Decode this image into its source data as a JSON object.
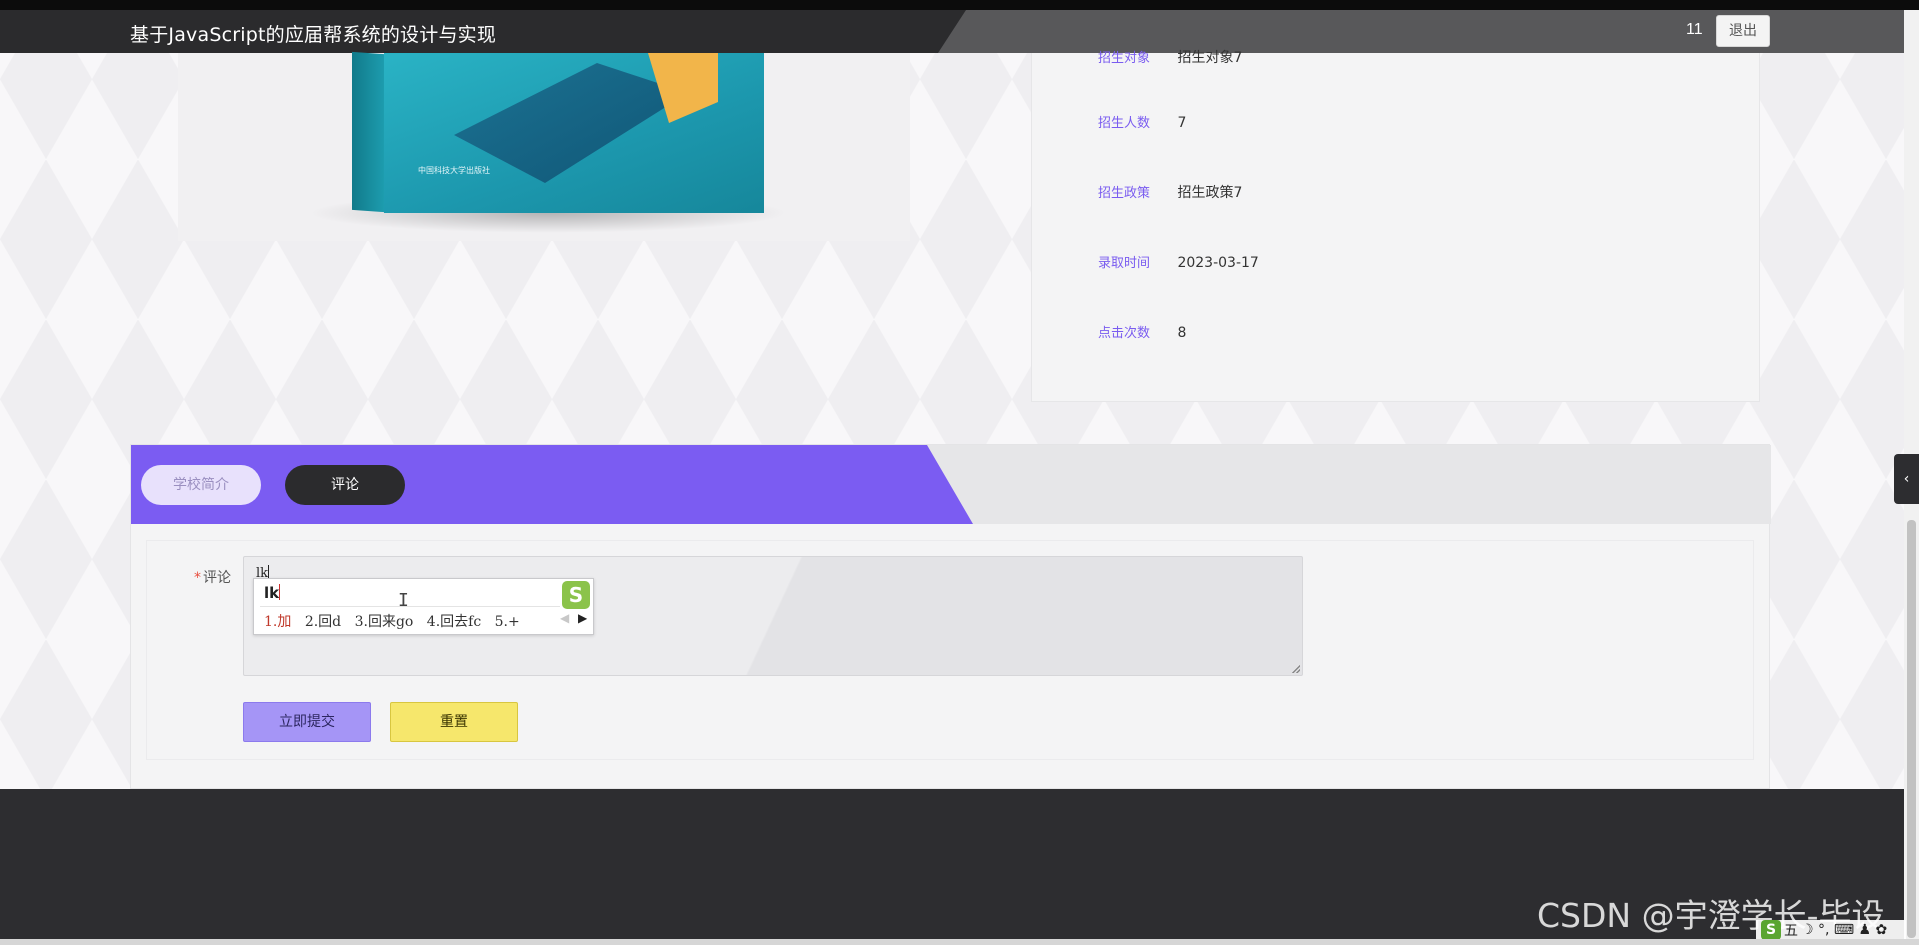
{
  "header": {
    "site_title": "基于JavaScript的应届帮系统的设计与实现",
    "user_name": "11",
    "logout_label": "退出"
  },
  "product_image": {
    "publisher_text": "中国科技大学出版社"
  },
  "details": [
    {
      "label": "招生对象",
      "value": "招生对象7"
    },
    {
      "label": "招生人数",
      "value": "7"
    },
    {
      "label": "招生政策",
      "value": "招生政策7"
    },
    {
      "label": "录取时间",
      "value": "2023-03-17"
    },
    {
      "label": "点击次数",
      "value": "8"
    }
  ],
  "tabs": [
    {
      "label": "学校简介",
      "active": false
    },
    {
      "label": "评论",
      "active": true
    }
  ],
  "form": {
    "required_mark": "*",
    "comment_label": "评论",
    "comment_value": "lk",
    "submit_label": "立即提交",
    "reset_label": "重置"
  },
  "ime": {
    "composition": "lk",
    "candidates": [
      "1.加",
      "2.回d",
      "3.回来go",
      "4.回去fc",
      "5.+"
    ],
    "logo": "S",
    "prev_glyph": "◀",
    "next_glyph": "▶"
  },
  "text_cursor_glyph": "I",
  "side_toggle_glyph": "‹",
  "watermark": "CSDN @宇澄学长-毕设",
  "tray": {
    "logo": "S",
    "mode_label": "五",
    "icons": "☽ °, ⌨ ♟ ✿"
  },
  "colors": {
    "accent_purple": "#7b5cf2",
    "header_dark": "#2b2b2d",
    "reset_yellow": "#f6e76c",
    "submit_purple": "#a595f6"
  }
}
